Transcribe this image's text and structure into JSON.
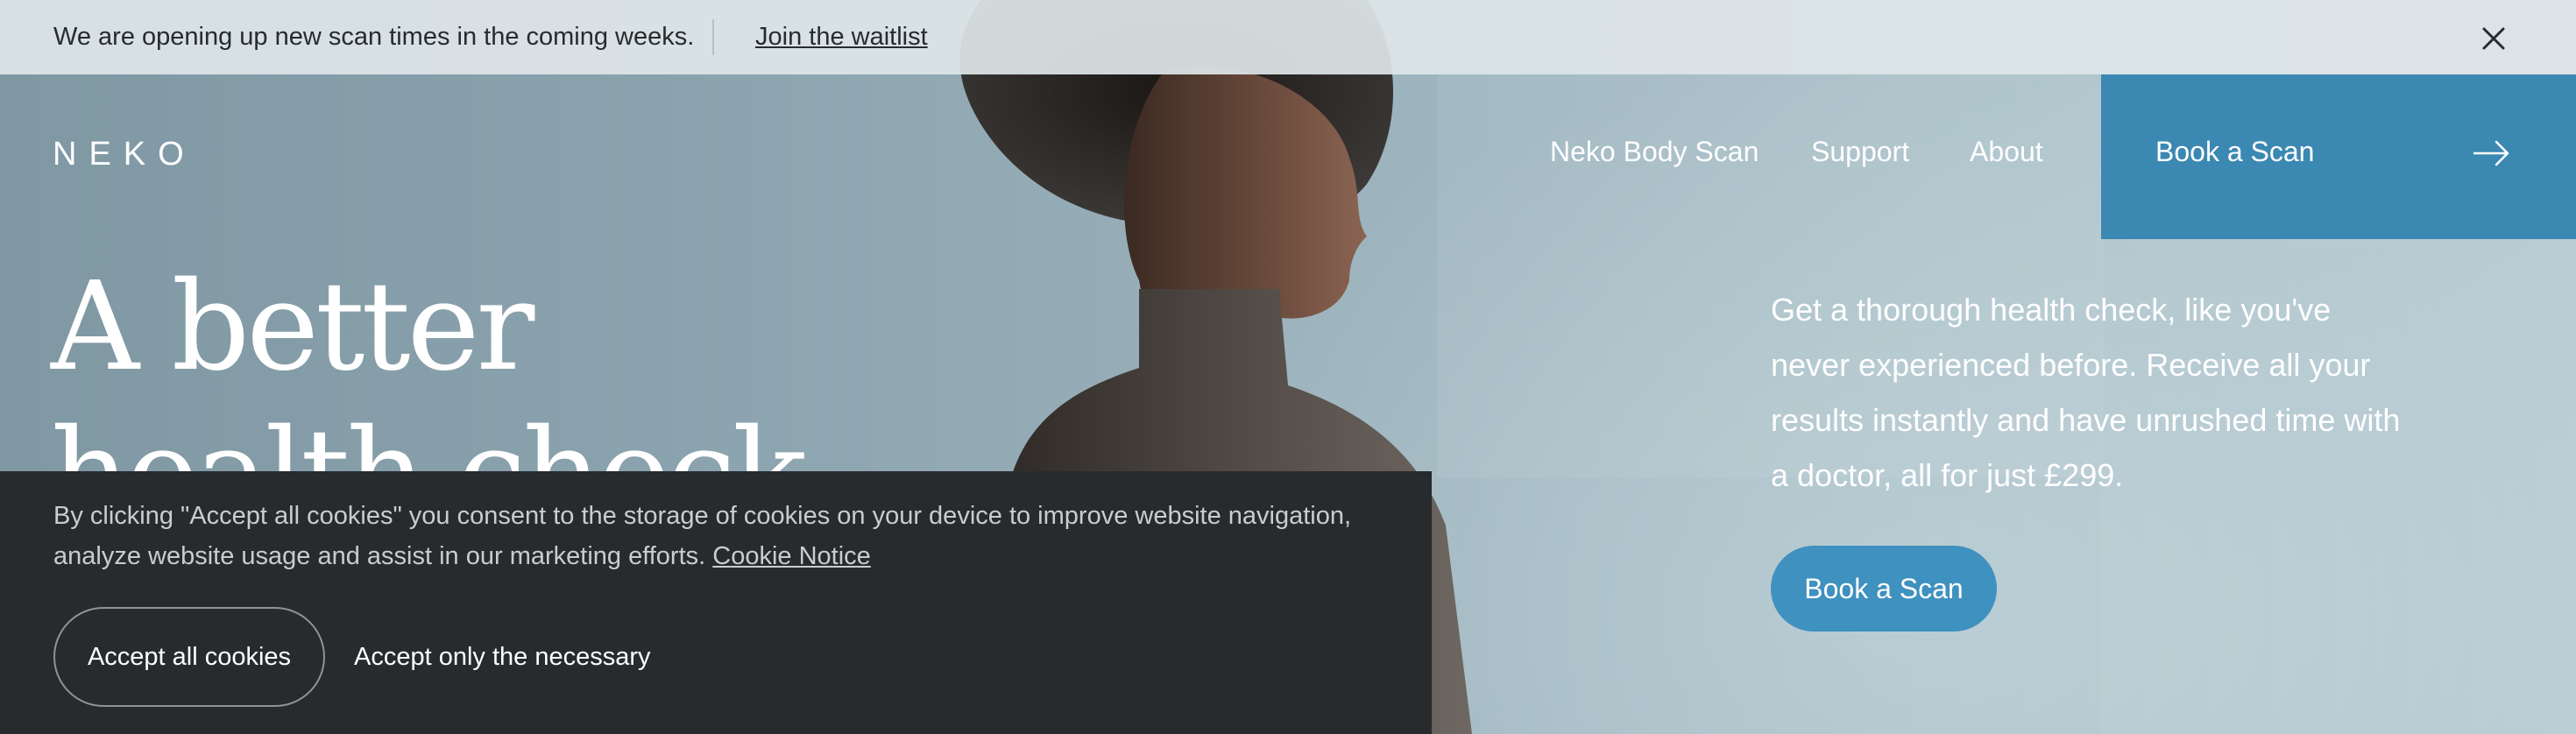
{
  "announcement": {
    "text": "We are opening up new scan times in the coming weeks.",
    "link_label": "Join the waitlist"
  },
  "header": {
    "logo": "NEKO",
    "nav": [
      {
        "label": "Neko Body Scan"
      },
      {
        "label": "Support"
      },
      {
        "label": "About"
      }
    ],
    "cta_label": "Book a Scan"
  },
  "hero": {
    "headline": "A better health check",
    "description": "Get a thorough health check, like you've never experienced before. Receive all your results instantly and have unrushed time with a doctor, all for just £299.",
    "cta_label": "Book a Scan"
  },
  "cookie_banner": {
    "text": "By clicking \"Accept all cookies\" you consent to the storage of cookies on your device to improve website navigation, analyze website usage and assist in our marketing efforts.",
    "link_label": "Cookie Notice",
    "accept_all_label": "Accept all cookies",
    "accept_necessary_label": "Accept only the necessary"
  },
  "colors": {
    "brand_blue": "#3b88b2",
    "hero_button_blue": "#3f91bf",
    "cookie_bg": "#272b2e",
    "announcement_bg": "#dee5e7"
  },
  "icons": {
    "close": "close-icon",
    "arrow": "arrow-right-icon"
  }
}
